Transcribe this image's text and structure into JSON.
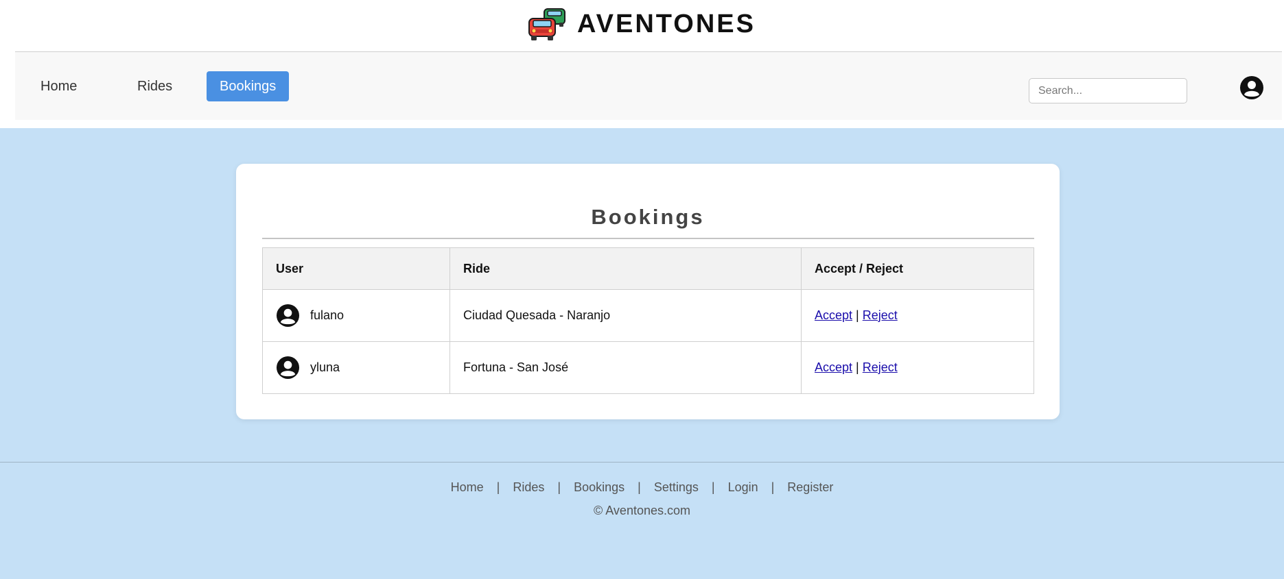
{
  "brand": {
    "title": "AVENTONES"
  },
  "nav": {
    "home": "Home",
    "rides": "Rides",
    "bookings": "Bookings",
    "active": "bookings"
  },
  "search": {
    "placeholder": "Search...",
    "value": ""
  },
  "icons": {
    "logo": "cars-logo-icon",
    "user": "user-circle-icon"
  },
  "colors": {
    "accent": "#4a90e2",
    "page_background": "#c5e0f6",
    "link": "#1a0dab"
  },
  "main": {
    "title": "Bookings",
    "table": {
      "headers": [
        "User",
        "Ride",
        "Accept / Reject"
      ],
      "rows": [
        {
          "user": "fulano",
          "ride": "Ciudad Quesada - Naranjo",
          "accept": "Accept",
          "separator": "|",
          "reject": "Reject"
        },
        {
          "user": "yluna",
          "ride": "Fortuna - San José",
          "accept": "Accept",
          "separator": "|",
          "reject": "Reject"
        }
      ]
    }
  },
  "footer": {
    "links": [
      "Home",
      "Rides",
      "Bookings",
      "Settings",
      "Login",
      "Register"
    ],
    "separator": "|",
    "copyright": "© Aventones.com"
  }
}
